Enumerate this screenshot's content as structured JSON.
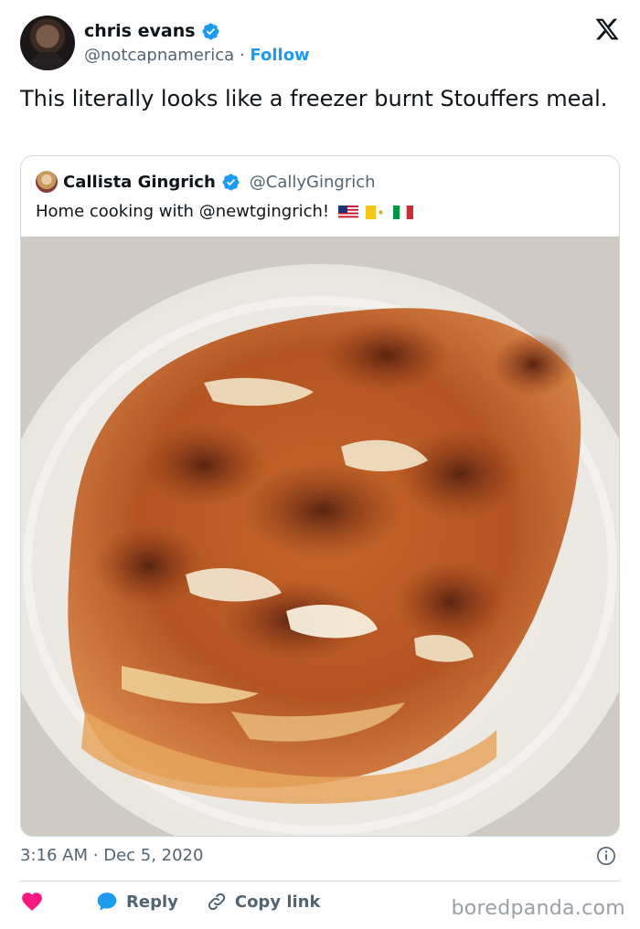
{
  "author": {
    "name": "chris evans",
    "handle": "@notcapnamerica",
    "separator": "·",
    "follow_label": "Follow"
  },
  "tweet": {
    "text": "This literally looks like a freezer burnt Stouffers meal."
  },
  "quote": {
    "name": "Callista Gingrich",
    "handle": "@CallyGingrich",
    "text": "Home cooking with @newtgingrich!",
    "flags": [
      "us-flag",
      "vatican-flag",
      "italy-flag"
    ]
  },
  "meta": {
    "time": "3:16 AM",
    "separator": "·",
    "date": "Dec 5, 2020"
  },
  "actions": {
    "reply_label": "Reply",
    "copy_label": "Copy link"
  },
  "watermark": "boredpanda.com",
  "colors": {
    "accent": "#1d9bf0",
    "heart": "#f91880",
    "muted": "#536471",
    "border": "#cfd9de"
  }
}
